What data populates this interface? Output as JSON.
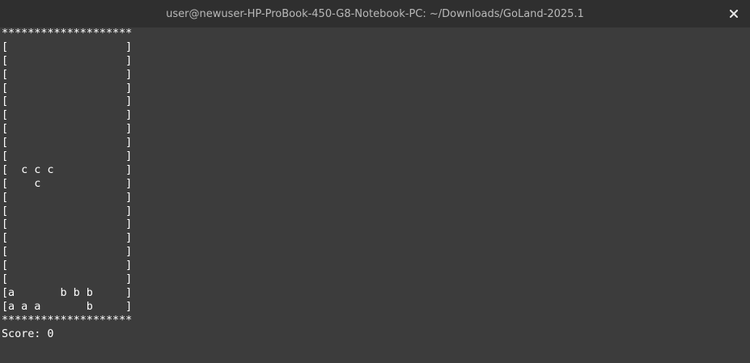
{
  "window": {
    "title": "user@newuser-HP-ProBook-450-G8-Notebook-PC: ~/Downloads/GoLand-2025.1",
    "close_icon": "close-icon"
  },
  "colors": {
    "titlebar_bg": "#2f2f2f",
    "terminal_bg": "#3c3c3c",
    "text": "#ffffff",
    "title_text": "#b9b9b9"
  },
  "terminal": {
    "lines": [
      "********************",
      "[                  ]",
      "[                  ]",
      "[                  ]",
      "[                  ]",
      "[                  ]",
      "[                  ]",
      "[                  ]",
      "[                  ]",
      "[                  ]",
      "[  c c c           ]",
      "[    c             ]",
      "[                  ]",
      "[                  ]",
      "[                  ]",
      "[                  ]",
      "[                  ]",
      "[                  ]",
      "[                  ]",
      "[a       b b b     ]",
      "[a a a       b     ]",
      "********************",
      "Score: 0"
    ]
  }
}
